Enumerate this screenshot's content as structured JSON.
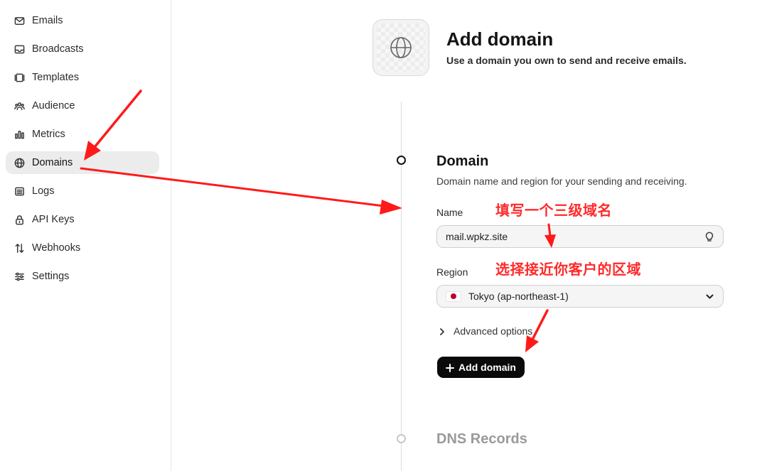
{
  "sidebar": {
    "items": [
      {
        "label": "Emails",
        "icon": "mail-icon"
      },
      {
        "label": "Broadcasts",
        "icon": "inbox-icon"
      },
      {
        "label": "Templates",
        "icon": "templates-icon"
      },
      {
        "label": "Audience",
        "icon": "users-icon"
      },
      {
        "label": "Metrics",
        "icon": "bar-chart-icon"
      },
      {
        "label": "Domains",
        "icon": "globe-icon",
        "active": true
      },
      {
        "label": "Logs",
        "icon": "list-icon"
      },
      {
        "label": "API Keys",
        "icon": "lock-icon"
      },
      {
        "label": "Webhooks",
        "icon": "arrows-updown-icon"
      },
      {
        "label": "Settings",
        "icon": "sliders-icon"
      }
    ]
  },
  "header": {
    "title": "Add domain",
    "subtitle": "Use a domain you own to send and receive emails."
  },
  "domain_section": {
    "title": "Domain",
    "description": "Domain name and region for your sending and receiving.",
    "name_label": "Name",
    "name_value": "mail.wpkz.site",
    "region_label": "Region",
    "region_value": "Tokyo (ap-northeast-1)",
    "advanced_label": "Advanced options",
    "add_button_label": "Add domain"
  },
  "dns_section": {
    "title": "DNS Records"
  },
  "annotations": {
    "note_name": "填写一个三级域名",
    "note_region": "选择接近你客户的区域",
    "color": "#ff2a2a"
  }
}
